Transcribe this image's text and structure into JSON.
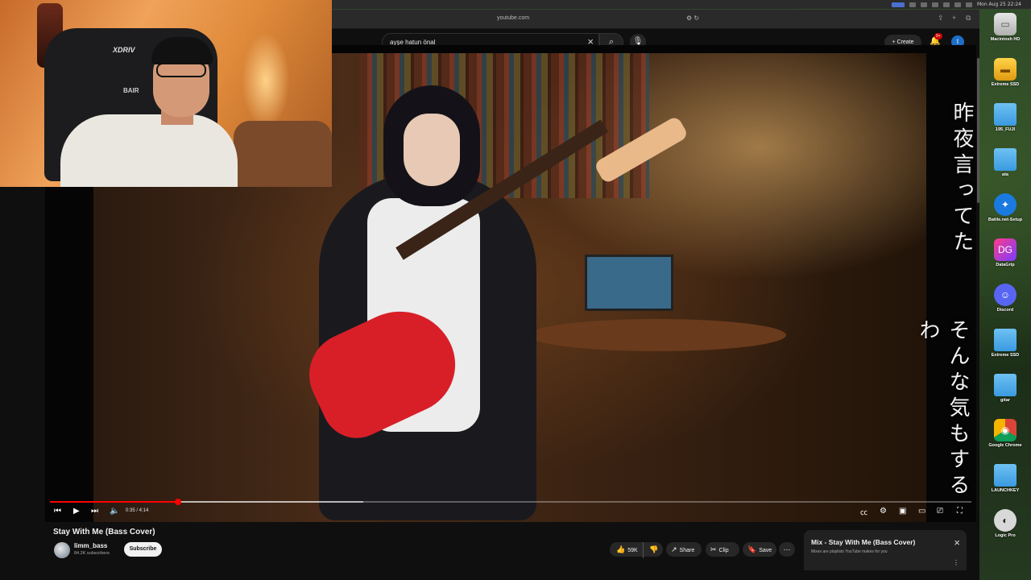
{
  "menubar": {
    "clock": "Mon Aug 25  22:24"
  },
  "browser": {
    "url": "youtube.com"
  },
  "youtube": {
    "search_query": "ayşe hatun önal",
    "create_label": "Create",
    "notification_badge": "9+",
    "account_initial": "t"
  },
  "video": {
    "lyrics": [
      "昨夜言ってた",
      "そんな気もするわ"
    ],
    "time": "0:35 / 4:14",
    "progress_played": 0.139,
    "progress_buffered": 0.34
  },
  "meta": {
    "title": "Stay With Me (Bass Cover)",
    "channel": "limm_bass",
    "subscribers": "84.2K subscribers",
    "subscribe_label": "Subscribe",
    "likes": "59K",
    "share_label": "Share",
    "clip_label": "Clip",
    "save_label": "Save"
  },
  "mix": {
    "title": "Mix - Stay With Me (Bass Cover)",
    "subtitle": "Mixes are playlists YouTube makes for you"
  },
  "webcam": {
    "chair_brand": "XDRIV",
    "chair_brand_2": "BAIR"
  },
  "desktop_icons": [
    {
      "label": "Macintosh HD",
      "icon": "hard-drive-icon"
    },
    {
      "label": "Extreme SSD",
      "icon": "ssd-icon"
    },
    {
      "label": "195_FUJI",
      "icon": "folder-icon"
    },
    {
      "label": "ata",
      "icon": "folder-icon"
    },
    {
      "label": "Battle.net-Setup",
      "icon": "battlenet-icon"
    },
    {
      "label": "DataGrip",
      "icon": "datagrip-icon"
    },
    {
      "label": "Discord",
      "icon": "discord-icon"
    },
    {
      "label": "Extreme SSD",
      "icon": "folder-icon"
    },
    {
      "label": "gitar",
      "icon": "folder-icon"
    },
    {
      "label": "Google Chrome",
      "icon": "chrome-icon"
    },
    {
      "label": "LAUNCHKEY",
      "icon": "folder-icon"
    },
    {
      "label": "Logic Pro",
      "icon": "logic-pro-icon"
    }
  ],
  "colors": {
    "accent": "#ff0000",
    "yt_bg": "#0f0f0f",
    "account": "#1e6ec8"
  }
}
